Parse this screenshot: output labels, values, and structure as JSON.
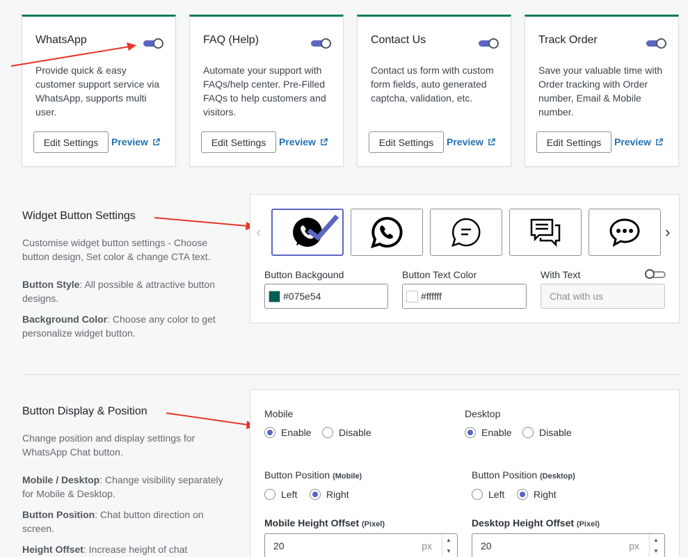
{
  "cards": [
    {
      "title": "WhatsApp",
      "desc": "Provide quick & easy customer support service via WhatsApp, supports multi user.",
      "edit_label": "Edit Settings",
      "preview_label": "Preview"
    },
    {
      "title": "FAQ (Help)",
      "desc": "Automate your support with FAQs/help center. Pre-Filled FAQs to help customers and visitors.",
      "edit_label": "Edit Settings",
      "preview_label": "Preview"
    },
    {
      "title": "Contact Us",
      "desc": "Contact us form with custom form fields, auto generated captcha, validation, etc.",
      "edit_label": "Edit Settings",
      "preview_label": "Preview"
    },
    {
      "title": "Track Order",
      "desc": "Save your valuable time with Order tracking with Order number, Email & Mobile number.",
      "edit_label": "Edit Settings",
      "preview_label": "Preview"
    }
  ],
  "widget": {
    "title": "Widget Button Settings",
    "desc": "Customise widget button settings - Choose button design, Set color & change CTA text.",
    "style_label": "Button Style",
    "style_desc": ": All possible & attractive button designs.",
    "bg_label": "Background Color",
    "bg_desc": ": Choose any color to get personalize widget button.",
    "styles": [
      "whatsapp-filled",
      "whatsapp-outline",
      "chat-bubble-lines",
      "chat-double-bubble",
      "chat-dots"
    ],
    "fields": {
      "bg_label": "Button Backgound",
      "bg_value": "#075e54",
      "text_color_label": "Button Text Color",
      "text_color_value": "#ffffff",
      "with_text_label": "With Text",
      "with_text_placeholder": "Chat with us"
    }
  },
  "display": {
    "title": "Button Display & Position",
    "desc": "Change position and display settings for WhatsApp Chat button.",
    "md_label": "Mobile / Desktop",
    "md_desc": ": Change visibility separately for Mobile & Desktop.",
    "pos_label": "Button Position",
    "pos_desc": ": Chat button direction on screen.",
    "offset_label": "Height Offset",
    "offset_desc": ": Increase height of chat",
    "mobile_label": "Mobile",
    "desktop_label": "Desktop",
    "enable": "Enable",
    "disable": "Disable",
    "bp_label": "Button Position",
    "bp_mobile": "(Mobile)",
    "bp_desktop": "(Desktop)",
    "left": "Left",
    "right": "Right",
    "mho_label": "Mobile Height Offset",
    "dho_label": "Desktop Height Offset",
    "pixel": "(Pixel)",
    "mobile_offset": "20",
    "desktop_offset": "20",
    "unit": "px"
  },
  "colors": {
    "accent": "#5b66c2",
    "card_top": "#0d7a5f",
    "link": "#2271b1",
    "arrow": "#e8362a",
    "bg_swatch": "#075e54",
    "text_swatch": "#ffffff"
  }
}
